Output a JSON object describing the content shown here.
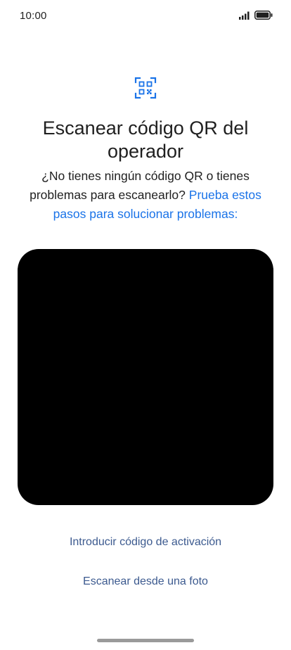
{
  "status_bar": {
    "time": "10:00",
    "icons": [
      "signal-icon",
      "battery-icon"
    ]
  },
  "header": {
    "icon": "qr-code-icon",
    "title": "Escanear código QR del operador",
    "subtitle": "¿No tienes ningún código QR o tienes problemas para escanearlo?",
    "help_link": "Prueba estos pasos para solucionar problemas:"
  },
  "actions": {
    "enter_code": "Introducir código de activación",
    "scan_photo": "Escanear desde una foto"
  },
  "colors": {
    "accent": "#1a73e8",
    "action_text": "#3c5a8f",
    "camera_bg": "#000000"
  }
}
